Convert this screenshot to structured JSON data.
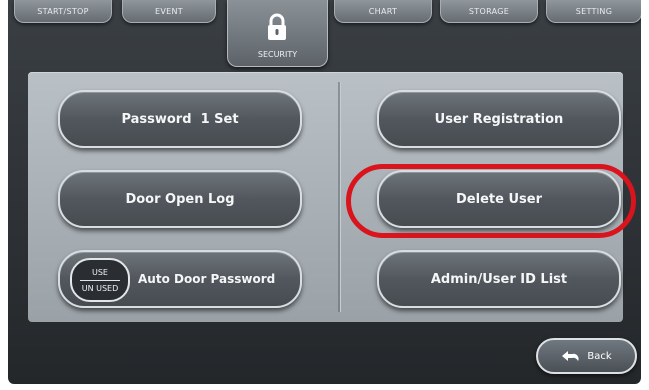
{
  "tabs": {
    "start_stop": "START/STOP",
    "event": "EVENT",
    "security": "SECURITY",
    "chart": "CHART",
    "storage": "STORAGE",
    "setting": "SETTING"
  },
  "active_tab_icon": "lock-icon",
  "buttons": {
    "password_set": "Password  1 Set",
    "user_registration": "User Registration",
    "door_open_log": "Door Open Log",
    "delete_user": "Delete User",
    "auto_door_password": "Auto Door Password",
    "admin_user_id_list": "Admin/User ID List"
  },
  "toggle": {
    "use": "USE",
    "unused": "UN USED"
  },
  "back": {
    "label": "Back",
    "icon": "back-arrow-icon"
  },
  "colors": {
    "highlight": "#d9141c",
    "button": "#51575d",
    "panel": "#aab1b7"
  }
}
